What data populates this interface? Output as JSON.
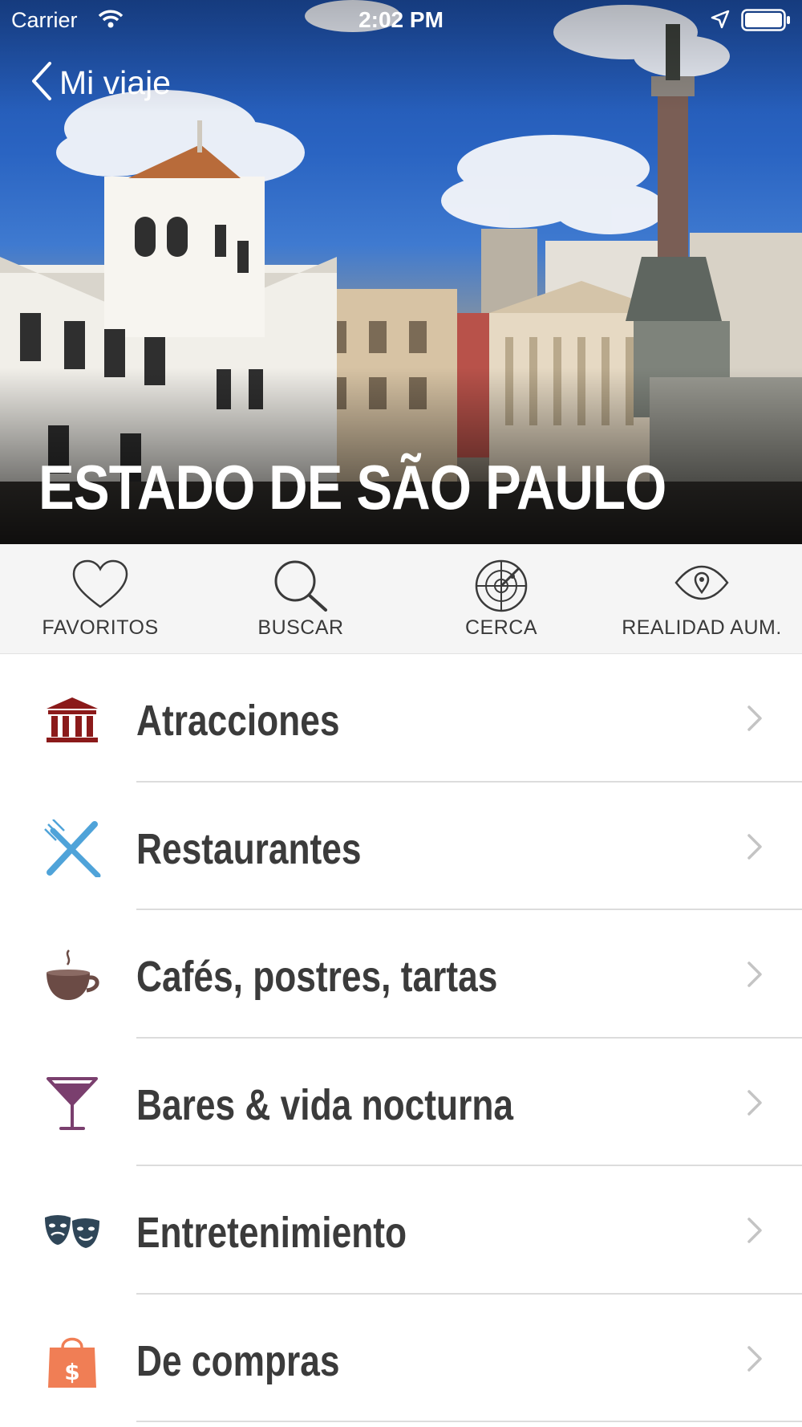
{
  "status_bar": {
    "carrier": "Carrier",
    "time": "2:02 PM"
  },
  "nav": {
    "back_label": "Mi viaje"
  },
  "hero": {
    "title": "ESTADO DE SÃO PAULO"
  },
  "toolbar": {
    "items": [
      {
        "label": "FAVORITOS",
        "icon": "heart-icon"
      },
      {
        "label": "BUSCAR",
        "icon": "search-icon"
      },
      {
        "label": "CERCA",
        "icon": "radar-icon"
      },
      {
        "label": "REALIDAD AUM.",
        "icon": "eye-pin-icon"
      }
    ]
  },
  "categories": [
    {
      "label": "Atracciones",
      "icon": "museum-icon",
      "color": "#8b1a1a"
    },
    {
      "label": "Restaurantes",
      "icon": "fork-knife-icon",
      "color": "#4fa3d9"
    },
    {
      "label": "Cafés, postres, tartas",
      "icon": "coffee-cup-icon",
      "color": "#6b4b45"
    },
    {
      "label": "Bares & vida nocturna",
      "icon": "cocktail-glass-icon",
      "color": "#7a3f6e"
    },
    {
      "label": "Entretenimiento",
      "icon": "theater-masks-icon",
      "color": "#2f4658"
    },
    {
      "label": "De compras",
      "icon": "shopping-bag-icon",
      "color": "#f07e55"
    }
  ]
}
